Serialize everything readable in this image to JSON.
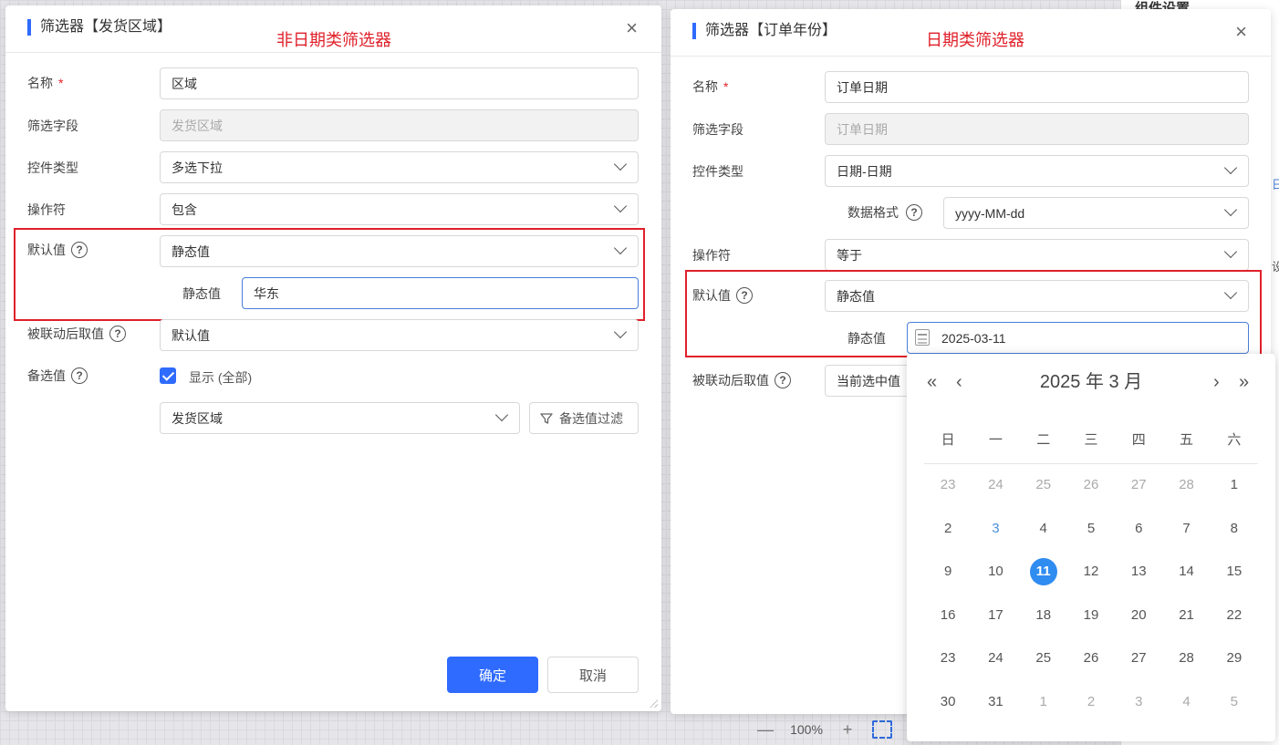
{
  "background": {
    "right_panel_title": "组件设置",
    "edge_mark_1": "日",
    "edge_mark_2": "设",
    "zoom": {
      "minus": "—",
      "value": "100%",
      "plus": "+"
    }
  },
  "left_dialog": {
    "title": "筛选器【发货区域】",
    "annotation": "非日期类筛选器",
    "close": "×",
    "name_label": "名称",
    "required_mark": "*",
    "name_value": "区域",
    "field_label": "筛选字段",
    "field_value": "发货区域",
    "control_type_label": "控件类型",
    "control_type_value": "多选下拉",
    "operator_label": "操作符",
    "operator_value": "包含",
    "default_label": "默认值",
    "default_value": "静态值",
    "static_label": "静态值",
    "static_value": "华东",
    "linked_label": "被联动后取值",
    "linked_value": "默认值",
    "candidate_label": "备选值",
    "show_all_label": "显示 (全部)",
    "show_all_checked": true,
    "candidate_source": "发货区域",
    "filter_button": "备选值过滤",
    "ok_button": "确定",
    "cancel_button": "取消"
  },
  "right_dialog": {
    "title": "筛选器【订单年份】",
    "annotation": "日期类筛选器",
    "close": "×",
    "name_label": "名称",
    "required_mark": "*",
    "name_value": "订单日期",
    "field_label": "筛选字段",
    "field_value": "订单日期",
    "control_type_label": "控件类型",
    "control_type_value": "日期-日期",
    "format_label": "数据格式",
    "format_value": "yyyy-MM-dd",
    "operator_label": "操作符",
    "operator_value": "等于",
    "default_label": "默认值",
    "default_value": "静态值",
    "static_label": "静态值",
    "static_value": "2025-03-11",
    "linked_label": "被联动后取值",
    "linked_value": "当前选中值"
  },
  "calendar": {
    "prev_year": "«",
    "prev_month": "‹",
    "title": "2025 年  3 月",
    "next_month": "›",
    "next_year": "»",
    "weekdays": [
      "日",
      "一",
      "二",
      "三",
      "四",
      "五",
      "六"
    ],
    "weeks": [
      [
        "23",
        "24",
        "25",
        "26",
        "27",
        "28",
        "1"
      ],
      [
        "2",
        "3",
        "4",
        "5",
        "6",
        "7",
        "8"
      ],
      [
        "9",
        "10",
        "11",
        "12",
        "13",
        "14",
        "15"
      ],
      [
        "16",
        "17",
        "18",
        "19",
        "20",
        "21",
        "22"
      ],
      [
        "23",
        "24",
        "25",
        "26",
        "27",
        "28",
        "29"
      ],
      [
        "30",
        "31",
        "1",
        "2",
        "3",
        "4",
        "5"
      ]
    ],
    "selected_day": "11",
    "today_day": "3"
  }
}
